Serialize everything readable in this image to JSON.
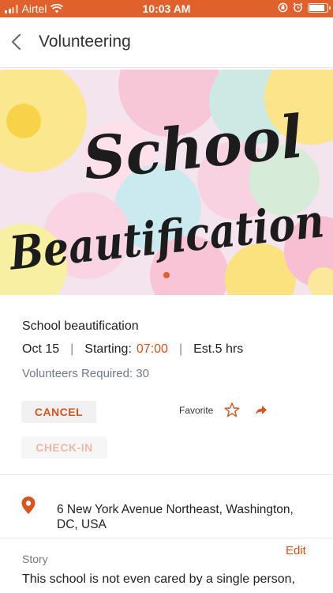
{
  "status_bar": {
    "carrier": "Airtel",
    "time": "10:03 AM"
  },
  "header": {
    "title": "Volunteering"
  },
  "hero": {
    "line1": "School",
    "line2": "Beautification"
  },
  "event": {
    "title": "School beautification",
    "date": "Oct 15",
    "separator": "|",
    "starting_label": "Starting:",
    "starting_time": "07:00",
    "estimate": "Est.5  hrs",
    "volunteers_label": "Volunteers Required:",
    "volunteers_count": "30"
  },
  "actions": {
    "cancel": "CANCEL",
    "checkin": "CHECK-IN",
    "favorite": "Favorite"
  },
  "location": {
    "address": "6 New York Avenue Northeast, Washington, DC, USA"
  },
  "story": {
    "label": "Story",
    "edit": "Edit",
    "text": "This school is not even cared by a single person,"
  },
  "colors": {
    "accent": "#e0612b",
    "link": "#d9531e"
  }
}
